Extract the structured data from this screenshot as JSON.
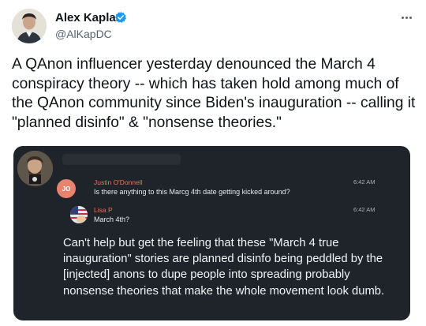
{
  "author": {
    "name": "Alex Kaplan",
    "handle": "@AlKapDC",
    "avatar_icon": "user-avatar",
    "verified_icon": "verified-badge-icon"
  },
  "more_icon": "more-options-icon",
  "tweet": {
    "text": "A QAnon influencer yesterday denounced the March 4 conspiracy theory -- which has taken hold among much of the QAnon community since Biden's inauguration -- calling it \"planned disinfo\" & \"nonsense theories.\""
  },
  "embedded_screenshot": {
    "messages": [
      {
        "avatar_initials": "JO",
        "name": "Justin O'Donnell",
        "text": "Is there anything to this Marcg 4th date getting kicked around?",
        "time": "6:42 AM"
      },
      {
        "avatar_icon": "flag-avatar",
        "name": "Lisa P",
        "text": "March 4th?",
        "time": "6:42 AM"
      }
    ],
    "quote": "Can't help but get the feeling that these \"March 4 true inauguration\" stories are planned disinfo being peddled by the [injected] anons to dupe people into spreading probably nonsense theories that make the whole movement look dumb."
  },
  "colors": {
    "verified": "#1d9bf0",
    "card_bg": "#1f232a",
    "accent_name": "#e8735e",
    "jo_avatar": "#e8836f"
  }
}
